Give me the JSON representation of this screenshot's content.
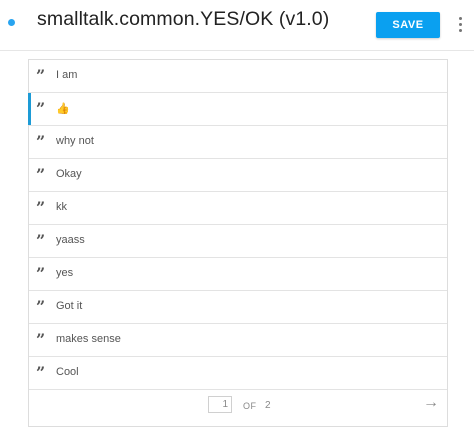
{
  "header": {
    "title": "smalltalk.common.YES/OK (v1.0)",
    "save_label": "SAVE",
    "accent_color": "#0aa0f0",
    "status_dot_color": "#29a4f0"
  },
  "utterances": [
    {
      "text": "I am"
    },
    {
      "text": "👍"
    },
    {
      "text": "why not"
    },
    {
      "text": "Okay"
    },
    {
      "text": "kk"
    },
    {
      "text": "yaass"
    },
    {
      "text": "yes"
    },
    {
      "text": "Got it"
    },
    {
      "text": "makes sense"
    },
    {
      "text": "Cool"
    }
  ],
  "selected_index": 1,
  "icons": {
    "item": "quote-icon",
    "menu": "more-vertical-icon",
    "next": "arrow-right-icon"
  },
  "pager": {
    "current_page": "1",
    "of_label": "OF",
    "total_pages": "2"
  }
}
